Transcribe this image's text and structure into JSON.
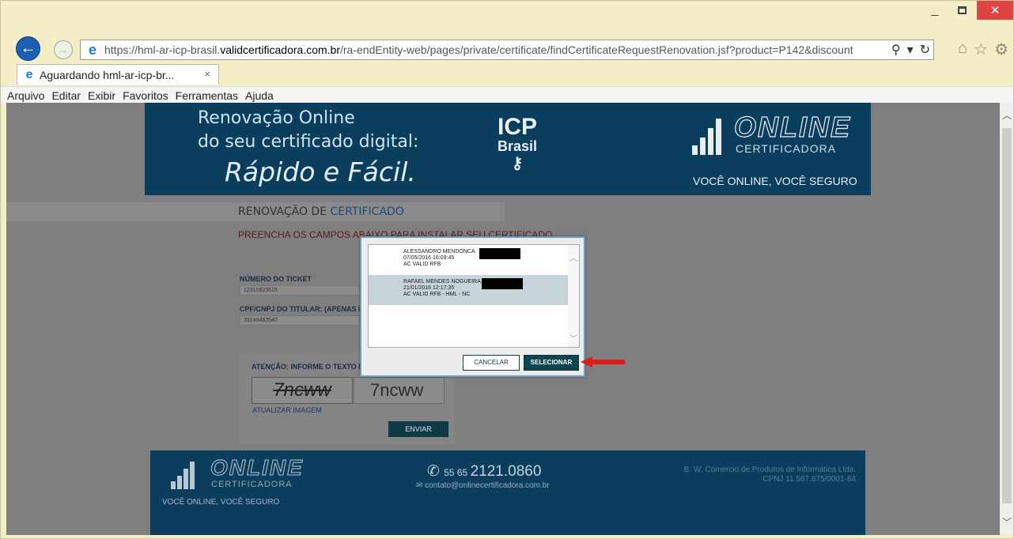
{
  "browser": {
    "url_prefix": "https://hml-ar-icp-brasil.",
    "url_domain": "validcertificadora.com.br",
    "url_path": "/ra-endEntity-web/pages/private/certificate/findCertificateRequestRenovation.jsf?product=P142&discount",
    "tab_title": "Aguardando hml-ar-icp-br...",
    "tab_close": "×",
    "back_glyph": "←",
    "forward_glyph": "→",
    "search_glyph": "⚲",
    "dropdown_glyph": "▾",
    "refresh_glyph": "↻",
    "home_glyph": "⌂",
    "favorites_glyph": "☆",
    "settings_glyph": "⚙",
    "minimize_glyph": "_",
    "close_glyph": "✕"
  },
  "menu": [
    "Arquivo",
    "Editar",
    "Exibir",
    "Favoritos",
    "Ferramentas",
    "Ajuda"
  ],
  "banner": {
    "line1": "Renovação Online",
    "line2": "do seu certificado digital:",
    "line3": "Rápido e Fácil.",
    "icp_top": "ICP",
    "icp_bottom": "Brasil",
    "brand_name": "ONLINE",
    "brand_sub": "CERTIFICADORA",
    "slogan": "VOCÊ ONLINE, VOCÊ SEGURO"
  },
  "page": {
    "section_title_prefix": "RENOVAÇÃO DE ",
    "section_title_accent": "CERTIFICADO",
    "instructions": "PREENCHA OS CAMPOS ABAIXO PARA INSTALAR SEU CERTIFICADO",
    "ticket_label": "NÚMERO DO TICKET",
    "ticket_value": "12310823616",
    "cpf_label": "CPF/CNPJ DO TITULAR: (APENAS NÚMEROS)",
    "cpf_value": "33149483540",
    "captcha_label": "ATENÇÃO: INFORME O TEXTO DA IMAGEM",
    "captcha_image_text": "7ncww",
    "captcha_value": "7ncww",
    "refresh_link": "ATUALIZAR IMAGEM",
    "send_button": "ENVIAR"
  },
  "footer": {
    "brand_name": "ONLINE",
    "brand_sub": "CERTIFICADORA",
    "slogan": "VOCÊ ONLINE, VOCÊ SEGURO",
    "phone_prefix": "55 65 ",
    "phone": "2121.0860",
    "email": "contato@onlinecertificadora.com.br",
    "company_line1": "B. W. Comercio de Produtos de Informática Ltda.",
    "company_line2": "CPNJ 11.587.875/0001-84"
  },
  "dialog": {
    "certificates": [
      {
        "name": "ALESSANDRO MENDONCA",
        "date": "07/05/2016 16:09:45",
        "issuer": "AC VALID RFB",
        "selected": false
      },
      {
        "name": "RAFAEL MENDES NOGUEIRA",
        "date": "21/01/2016 12:17:35",
        "issuer": "AC VALID RFB - HML - NC",
        "selected": true
      }
    ],
    "cancel_button": "CANCELAR",
    "select_button": "SELECIONAR"
  }
}
